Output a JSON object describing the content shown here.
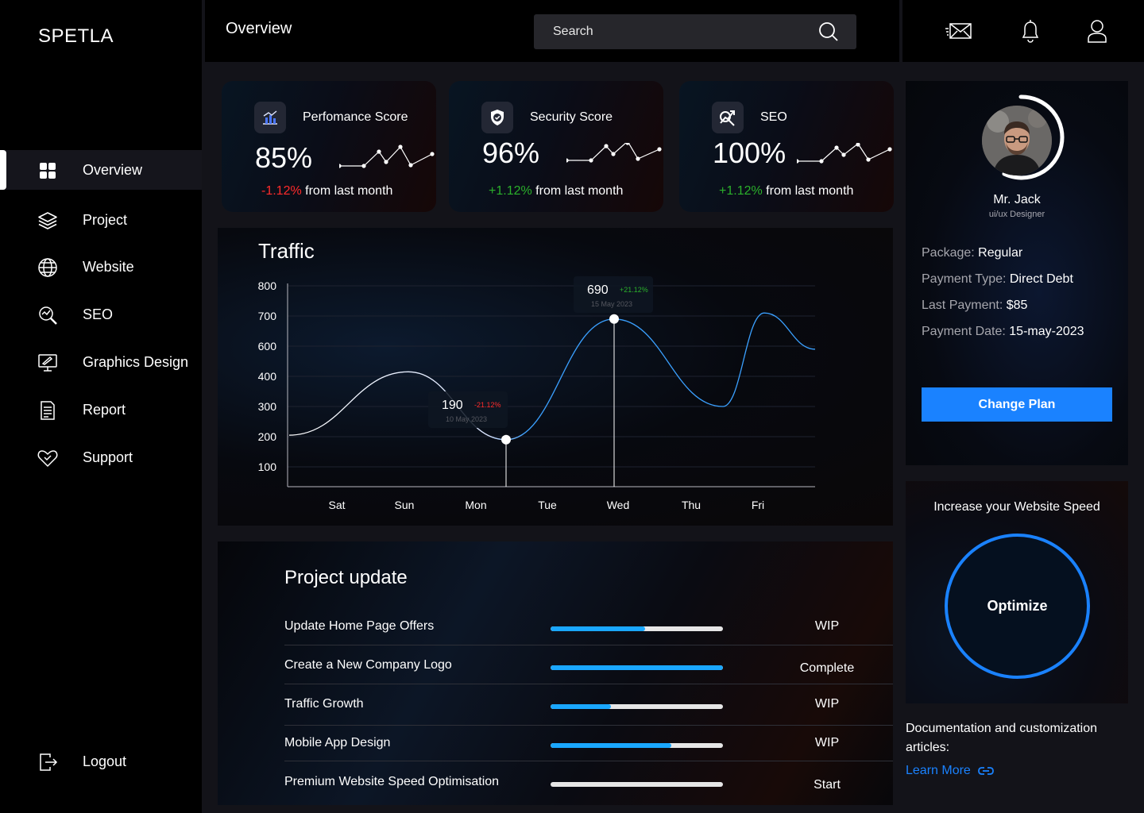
{
  "brand": "SPETLA",
  "page_title": "Overview",
  "search": {
    "placeholder": "Search"
  },
  "nav": {
    "items": [
      {
        "label": "Overview",
        "icon": "grid-icon"
      },
      {
        "label": "Project",
        "icon": "layers-icon"
      },
      {
        "label": "Website",
        "icon": "globe-icon"
      },
      {
        "label": "SEO",
        "icon": "seo-search-icon"
      },
      {
        "label": "Graphics Design",
        "icon": "monitor-design-icon"
      },
      {
        "label": "Report",
        "icon": "document-icon"
      },
      {
        "label": "Support",
        "icon": "heart-hand-icon"
      }
    ],
    "logout": "Logout"
  },
  "header_icons": [
    "mail-icon",
    "bell-icon",
    "user-icon"
  ],
  "cards": [
    {
      "title": "Perfomance Score",
      "value": "85%",
      "change": "-1.12%",
      "suffix": " from last month",
      "trend": "down",
      "icon": "performance-chart-icon"
    },
    {
      "title": "Security Score",
      "value": "96%",
      "change": "+1.12%",
      "suffix": " from last month",
      "trend": "up",
      "icon": "shield-check-icon"
    },
    {
      "title": "SEO",
      "value": "100%",
      "change": "+1.12%",
      "suffix": " from last month",
      "trend": "up",
      "icon": "seo-magnify-icon"
    }
  ],
  "traffic": {
    "title": "Traffic",
    "tooltips": [
      {
        "value": "190",
        "change": "-21.12%",
        "date": "10 May 2023"
      },
      {
        "value": "690",
        "change": "+21.12%",
        "date": "15 May 2023"
      }
    ]
  },
  "chart_data": {
    "type": "line",
    "title": "Traffic",
    "categories": [
      "Sat",
      "Sun",
      "Mon",
      "Tue",
      "Wed",
      "Thu",
      "Fri"
    ],
    "y_ticks": [
      "800",
      "700",
      "600",
      "400",
      "300",
      "200",
      "100"
    ],
    "series": [
      {
        "values": [
          210,
          430,
          190,
          540,
          690,
          420,
          710
        ]
      }
    ],
    "highlights": [
      {
        "x": "Mon",
        "y": 190
      },
      {
        "x": "Wed",
        "y": 690
      }
    ],
    "grid": true
  },
  "projects": {
    "title": "Project update",
    "rows": [
      {
        "name": "Update Home Page Offers",
        "progress": 0.55,
        "status": "WIP"
      },
      {
        "name": "Create a New Company Logo",
        "progress": 1.0,
        "status": "Complete"
      },
      {
        "name": "Traffic Growth",
        "progress": 0.35,
        "status": "WIP"
      },
      {
        "name": "Mobile App Design",
        "progress": 0.7,
        "status": "WIP"
      },
      {
        "name": "Premium Website Speed Optimisation",
        "progress": 0.0,
        "status": "Start"
      }
    ]
  },
  "profile": {
    "name": "Mr. Jack",
    "role": "ui/ux Designer",
    "info": [
      {
        "label": "Package: ",
        "value": "Regular"
      },
      {
        "label": "Payment Type: ",
        "value": "Direct Debt"
      },
      {
        "label": "Last Payment: ",
        "value": "$85"
      },
      {
        "label": "Payment Date: ",
        "value": "15-may-2023"
      }
    ],
    "button": "Change Plan"
  },
  "speed": {
    "title": "Increase your Website Speed",
    "button": "Optimize"
  },
  "docs": {
    "text": "Documentation and customization articles:",
    "link": "Learn More"
  },
  "colors": {
    "accent": "#1a82ff",
    "progress": "#1aa7ff",
    "negative": "#ff2b2b",
    "positive": "#2bb02b"
  }
}
